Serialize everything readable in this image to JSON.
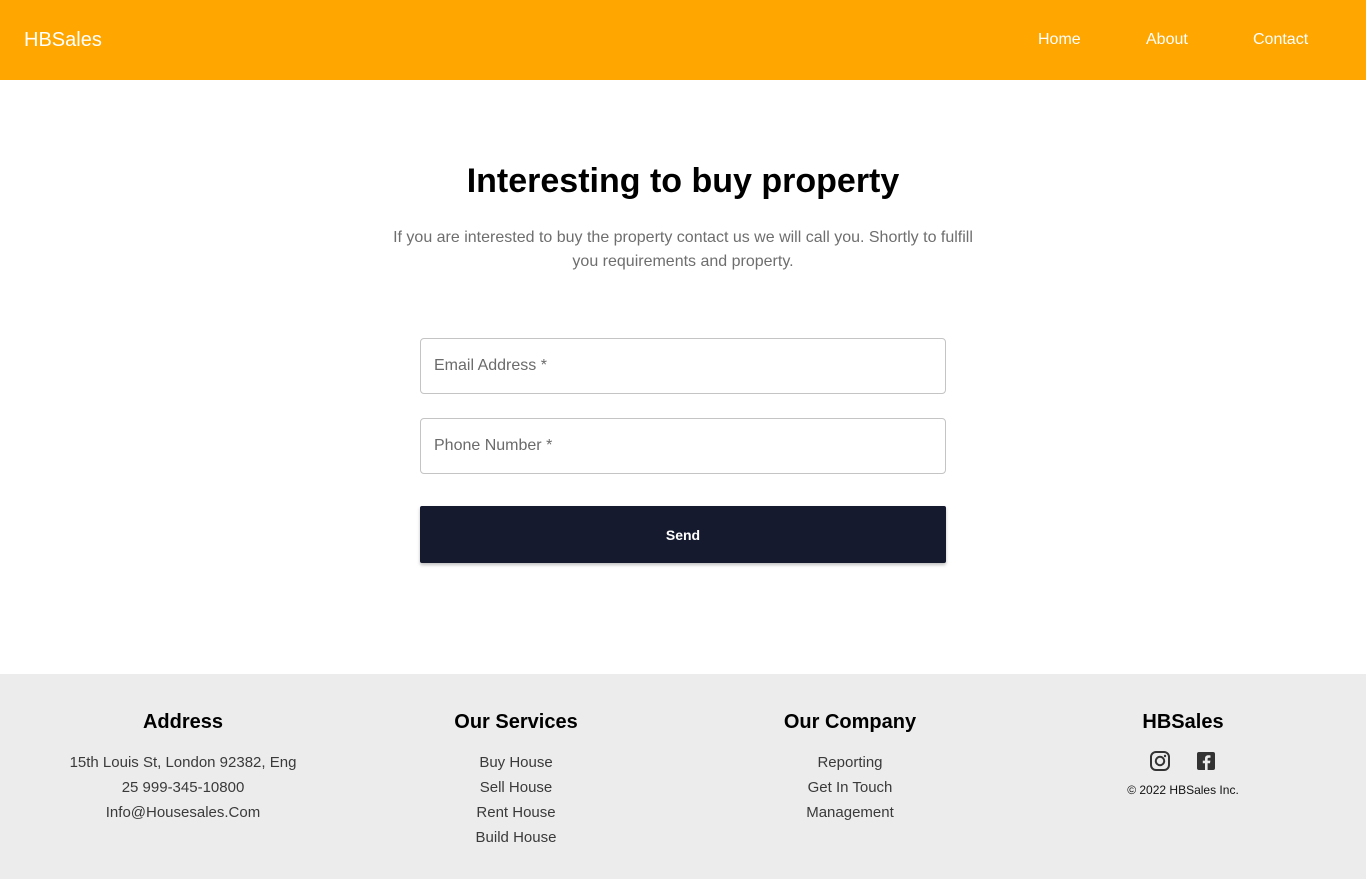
{
  "header": {
    "brand": "HBSales",
    "nav": {
      "home": "Home",
      "about": "About",
      "contact": "Contact"
    }
  },
  "hero": {
    "title": "Interesting to buy property",
    "subtitle": "If you are interested to buy the property contact us we will call you. Shortly to fulfill you requirements and property."
  },
  "form": {
    "email_placeholder": "Email Address *",
    "phone_placeholder": "Phone Number *",
    "send_label": "Send"
  },
  "footer": {
    "address": {
      "heading": "Address",
      "lines": [
        "15th Louis St, London 92382, Eng",
        "25 999-345-10800",
        "Info@Housesales.Com"
      ]
    },
    "services": {
      "heading": "Our Services",
      "items": [
        "Buy House",
        "Sell House",
        "Rent House",
        "Build House"
      ]
    },
    "company": {
      "heading": "Our Company",
      "items": [
        "Reporting",
        "Get In Touch",
        "Management"
      ]
    },
    "brand": {
      "heading": "HBSales",
      "socials": [
        "instagram-icon",
        "facebook-icon"
      ],
      "copyright": "© 2022 HBSales Inc."
    }
  },
  "colors": {
    "header_bg": "#ffa600",
    "button_bg": "#151a2e",
    "footer_bg": "#ececec"
  }
}
